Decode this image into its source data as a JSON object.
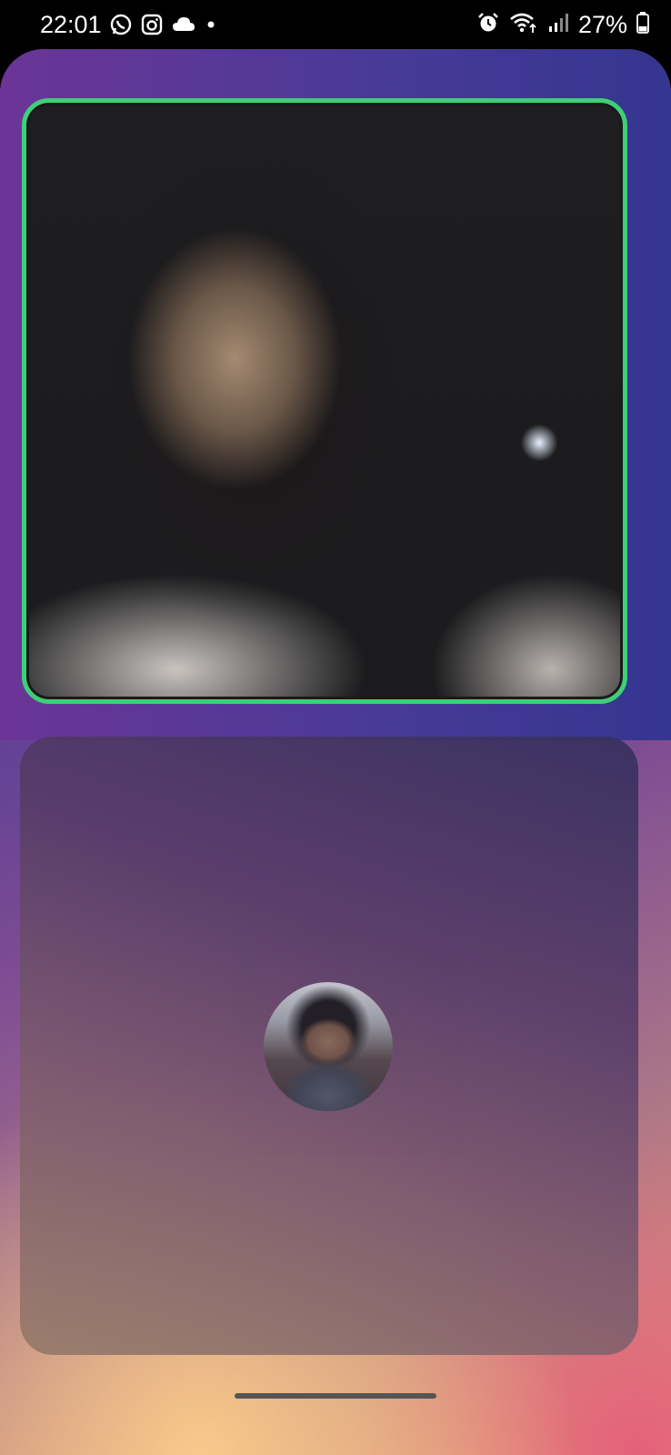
{
  "status_bar": {
    "time": "22:01",
    "left_icons": [
      "whatsapp-icon",
      "instagram-icon",
      "cloud-icon",
      "dot-icon"
    ],
    "right_icons": [
      "alarm-icon",
      "wifi-icon",
      "signal-icon",
      "battery-icon"
    ],
    "battery_percent": "27%"
  },
  "call": {
    "remote_video_active": true,
    "active_speaker_color": "#3ecf77",
    "local_tile_shows_avatar": true
  }
}
